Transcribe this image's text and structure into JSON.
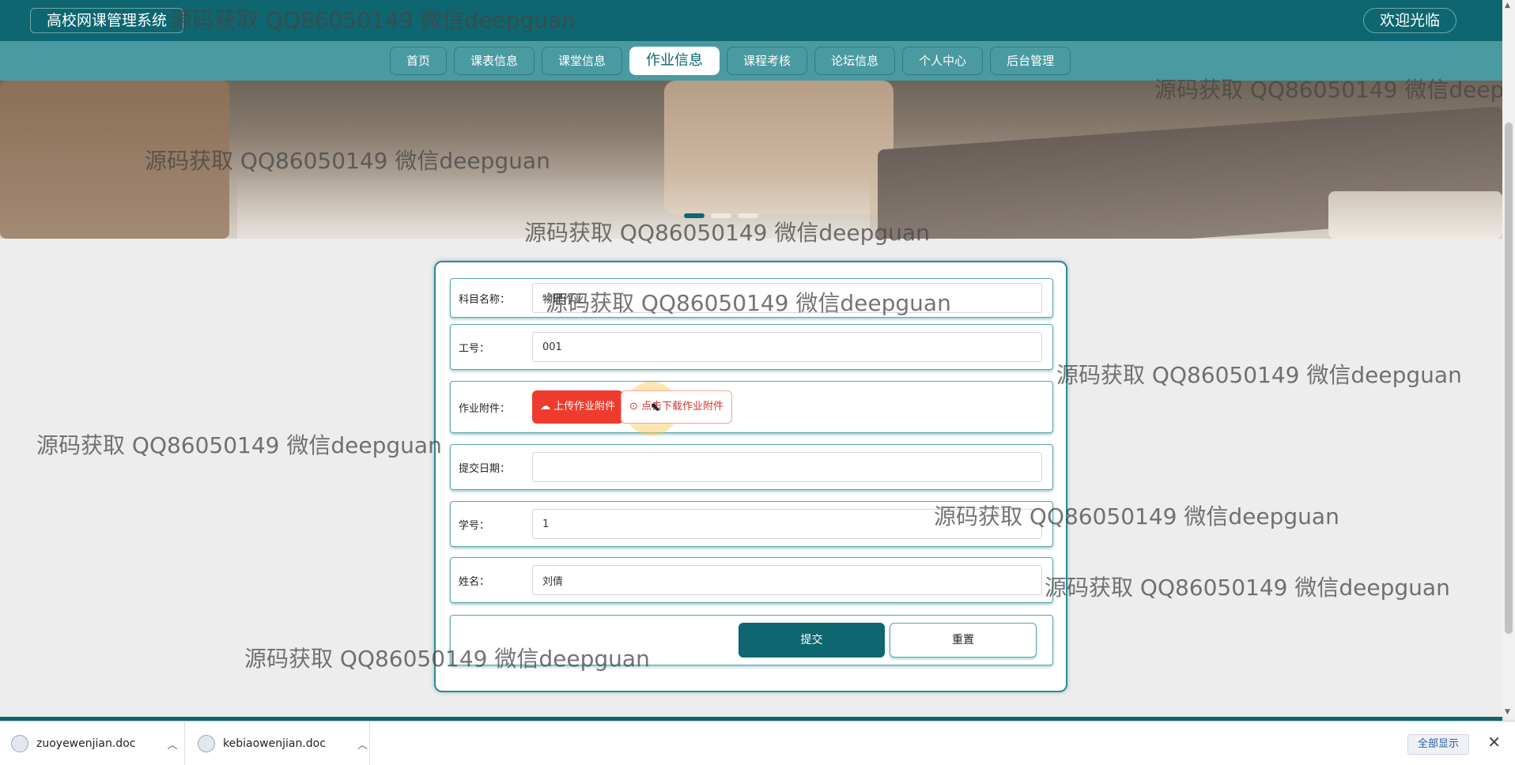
{
  "header": {
    "system_title": "高校网课管理系统",
    "welcome": "欢迎光临"
  },
  "nav": {
    "items": [
      "首页",
      "课表信息",
      "课堂信息",
      "作业信息",
      "课程考核",
      "论坛信息",
      "个人中心",
      "后台管理"
    ],
    "active_index": 3
  },
  "form": {
    "subject_label": "科目名称：",
    "subject_value": "物理作业",
    "staff_id_label": "工号：",
    "staff_id_value": "001",
    "attachment_label": "作业附件：",
    "upload_label": "上传作业附件",
    "download_label": "点击下载作业附件",
    "submit_date_label": "提交日期：",
    "submit_date_value": "",
    "student_id_label": "学号：",
    "student_id_value": "1",
    "name_label": "姓名：",
    "name_value": "刘倩",
    "submit_button": "提交",
    "reset_button": "重置"
  },
  "watermark": "源码获取 QQ86050149 微信deepguan",
  "download_bar": {
    "files": [
      "zuoyewenjian.doc",
      "kebiaowenjian.doc"
    ],
    "show_all": "全部显示"
  },
  "colors": {
    "primary": "#0e6670",
    "nav_bg": "#4a9aa1",
    "upload": "#ef3b2e"
  }
}
